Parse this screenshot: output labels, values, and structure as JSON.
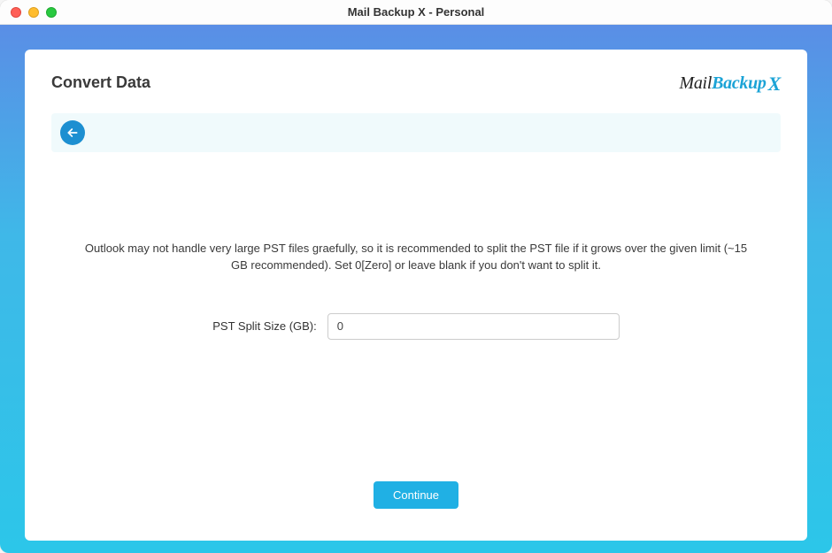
{
  "window": {
    "title": "Mail Backup X - Personal"
  },
  "header": {
    "page_title": "Convert Data",
    "logo": {
      "part1": "Mail",
      "part2": "Backup",
      "part3": "X"
    }
  },
  "body": {
    "info_text": "Outlook may not handle very large PST files graefully, so it is recommended to split the PST file if it grows over the given limit (~15 GB recommended). Set 0[Zero] or leave blank if you don't want to split it.",
    "split_size_label": "PST Split Size (GB):",
    "split_size_value": "0"
  },
  "footer": {
    "continue_label": "Continue"
  }
}
